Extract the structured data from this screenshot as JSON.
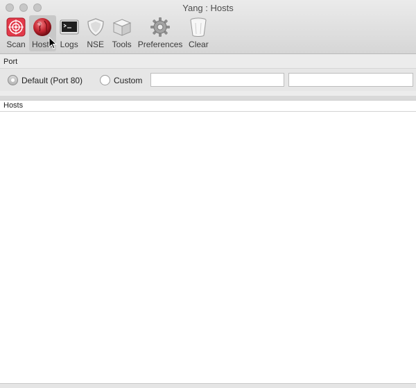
{
  "window": {
    "title": "Yang : Hosts"
  },
  "toolbar": {
    "items": [
      {
        "label": "Scan",
        "icon": "scan-target-icon"
      },
      {
        "label": "Hosts",
        "icon": "hosts-globe-icon"
      },
      {
        "label": "Logs",
        "icon": "terminal-icon"
      },
      {
        "label": "NSE",
        "icon": "shield-icon"
      },
      {
        "label": "Tools",
        "icon": "box-icon"
      },
      {
        "label": "Preferences",
        "icon": "gear-icon"
      },
      {
        "label": "Clear",
        "icon": "trash-icon"
      }
    ]
  },
  "port": {
    "section_label": "Port",
    "default_option": "Default (Port 80)",
    "custom_option": "Custom",
    "custom_value_1": "",
    "custom_value_2": ""
  },
  "hosts": {
    "header": "Hosts"
  },
  "colors": {
    "scan_accent": "#e23a4a",
    "hosts_accent": "#b0202a"
  }
}
